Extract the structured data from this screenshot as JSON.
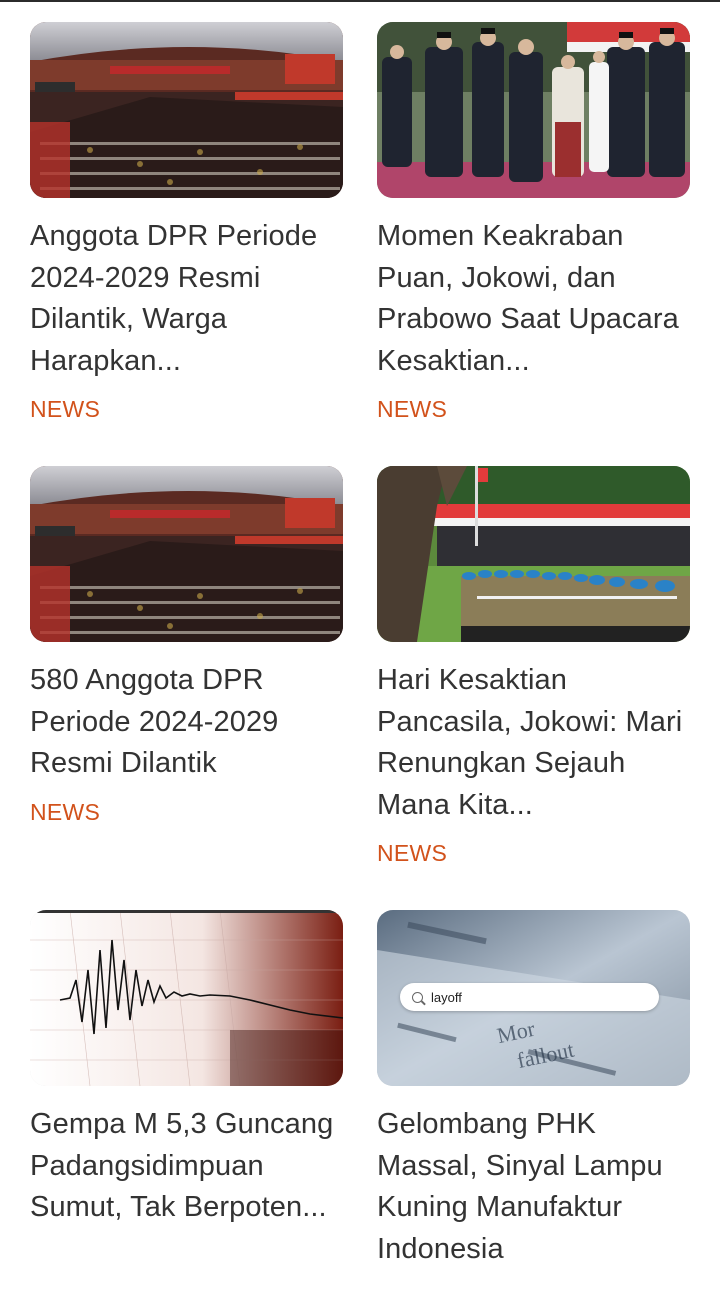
{
  "colors": {
    "category": "#d2521b",
    "title": "#333333",
    "background": "#ffffff"
  },
  "articles": [
    {
      "title": "Anggota DPR Periode 2024-2029 Resmi Dilantik, Warga Harapkan...",
      "category": "NEWS",
      "image": "parliament-hall-photo"
    },
    {
      "title": "Momen Keakraban Puan, Jokowi, dan Prabowo Saat Upacara Kesaktian...",
      "category": "NEWS",
      "image": "officials-ceremony-photo"
    },
    {
      "title": "580 Anggota DPR Periode 2024-2029 Resmi Dilantik",
      "category": "NEWS",
      "image": "parliament-hall-photo"
    },
    {
      "title": "Hari Kesaktian Pancasila, Jokowi: Mari Renungkan Sejauh Mana Kita...",
      "category": "NEWS",
      "image": "military-parade-photo"
    },
    {
      "title": "Gempa M 5,3 Guncang Padangsidimpuan Sumut, Tak Berpoten...",
      "category": "",
      "image": "seismograph-photo"
    },
    {
      "title": "Gelombang PHK Massal, Sinyal Lampu Kuning Manufaktur Indonesia",
      "category": "",
      "image": "layoff-search-photo",
      "image_search_text": "layoff"
    }
  ]
}
